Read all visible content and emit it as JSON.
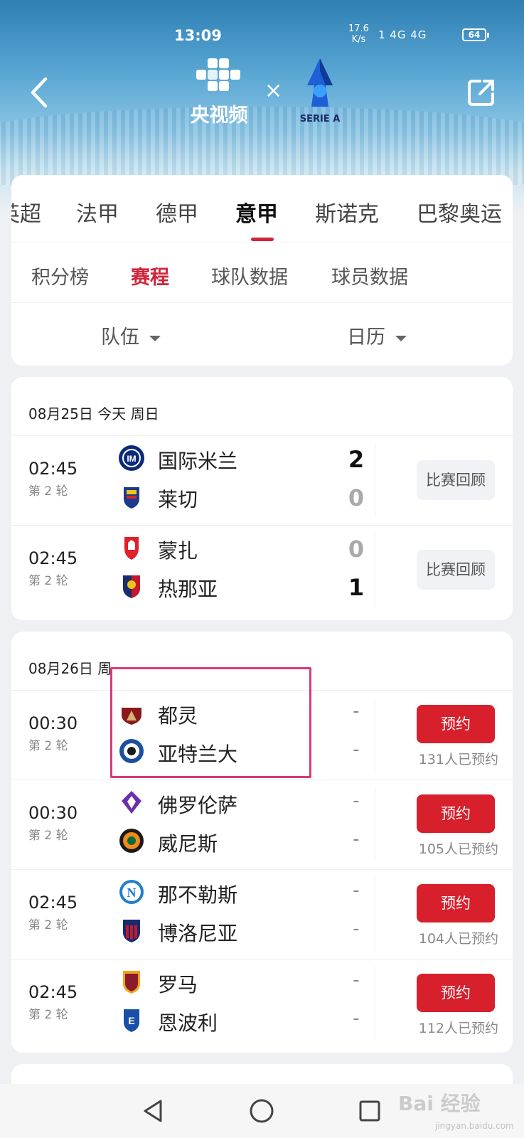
{
  "status_bar": {
    "time": "13:09",
    "speed_value": "17.6",
    "speed_unit": "K/s",
    "signal": "1 4G 4G",
    "battery": "64"
  },
  "header": {
    "brand_name": "央视频",
    "times_symbol": "×",
    "league_logo_text": "SERIE A"
  },
  "league_tabs": [
    "英超",
    "法甲",
    "德甲",
    "意甲",
    "斯诺克",
    "巴黎奥运"
  ],
  "active_league": "意甲",
  "sub_tabs": [
    "积分榜",
    "赛程",
    "球队数据",
    "球员数据"
  ],
  "active_sub_tab": "赛程",
  "filters": {
    "team": "队伍",
    "calendar": "日历"
  },
  "days": [
    {
      "date": "08月25日  今天  周日",
      "matches": [
        {
          "time": "02:45",
          "round": "第 2 轮",
          "home": "国际米兰",
          "away": "莱切",
          "home_score": "2",
          "away_score": "0",
          "action": "比赛回顾"
        },
        {
          "time": "02:45",
          "round": "第 2 轮",
          "home": "蒙扎",
          "away": "热那亚",
          "home_score": "0",
          "away_score": "1",
          "action": "比赛回顾"
        }
      ]
    },
    {
      "date": "08月26日  周一",
      "matches": [
        {
          "time": "00:30",
          "round": "第 2 轮",
          "home": "都灵",
          "away": "亚特兰大",
          "home_score": "-",
          "away_score": "-",
          "action": "预约",
          "count": "131人已预约"
        },
        {
          "time": "00:30",
          "round": "第 2 轮",
          "home": "佛罗伦萨",
          "away": "威尼斯",
          "home_score": "-",
          "away_score": "-",
          "action": "预约",
          "count": "105人已预约"
        },
        {
          "time": "02:45",
          "round": "第 2 轮",
          "home": "那不勒斯",
          "away": "博洛尼亚",
          "home_score": "-",
          "away_score": "-",
          "action": "预约",
          "count": "104人已预约"
        },
        {
          "time": "02:45",
          "round": "第 2 轮",
          "home": "罗马",
          "away": "恩波利",
          "home_score": "-",
          "away_score": "-",
          "action": "预约",
          "count": "112人已预约"
        }
      ]
    }
  ],
  "watermark": {
    "main": "Bai 经验",
    "sub": "jingyan.baidu.com"
  },
  "colors": {
    "accent": "#d81f2c",
    "tab_active": "#d0243a",
    "highlight_box": "#d83a7e"
  }
}
